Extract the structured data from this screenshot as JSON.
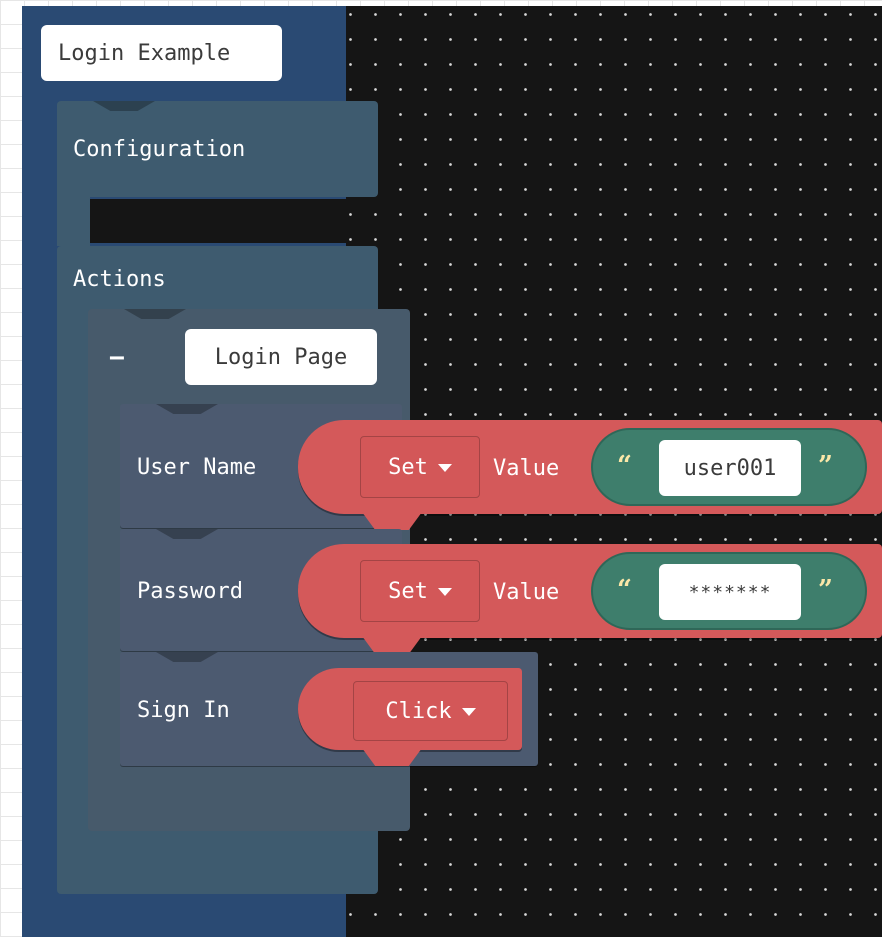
{
  "workspace": {
    "root_title": "Login Example",
    "configuration_label": "Configuration",
    "actions_label": "Actions",
    "collapse_symbol": "−",
    "page_title": "Login Page",
    "rows": [
      {
        "label": "User Name",
        "action": "Set",
        "value_label": "Value",
        "value": "user001"
      },
      {
        "label": "Password",
        "action": "Set",
        "value_label": "Value",
        "value": "*******"
      },
      {
        "label": "Sign In",
        "action": "Click"
      }
    ]
  },
  "colors": {
    "workspace_bg": "#151515",
    "root_block": "#2a4a73",
    "configuration_block": "#3e5b6f",
    "page_block": "#475a6b",
    "row_block": "#4c5a70",
    "action_block": "#d4595a",
    "text_pill": "#3e7e6c",
    "quote_mark": "#fbe7a8"
  },
  "icons": {
    "dropdown": "triangle-down-icon",
    "collapse": "minus-icon",
    "open_quote": "open-quote-icon",
    "close_quote": "close-quote-icon"
  }
}
